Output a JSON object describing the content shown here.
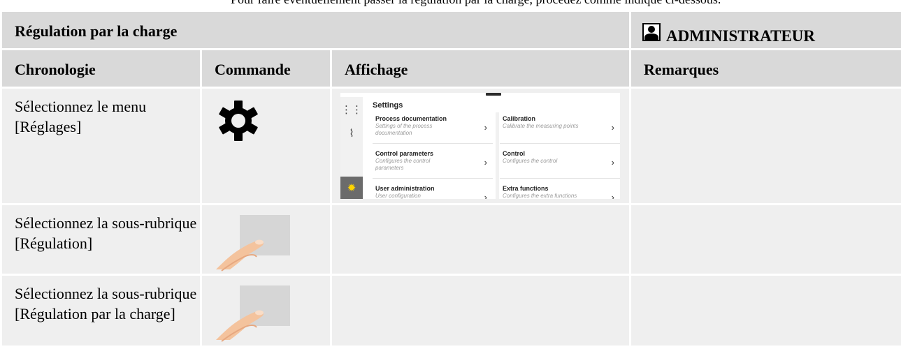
{
  "intro_text": "Pour faire éventuellement passer la régulation par la charge, procédez comme indiqué ci-dessous.",
  "header": {
    "title": "Régulation par la charge",
    "user_role": "ADMINISTRATEUR"
  },
  "columns": [
    "Chronologie",
    "Commande",
    "Affichage",
    "Remarques"
  ],
  "rows": [
    {
      "chronologie": "Sélectionnez le menu [Réglages]",
      "commande_icon": "gear-icon",
      "affichage": "settings-screen",
      "remarques": ""
    },
    {
      "chronologie": "Sélectionnez la sous-rubrique [Régulation]",
      "commande_icon": "touch-finger-icon",
      "affichage": "",
      "remarques": ""
    },
    {
      "chronologie": "Sélectionnez la sous-rubrique [Régulation par la charge]",
      "commande_icon": "touch-finger-icon",
      "affichage": "",
      "remarques": ""
    }
  ],
  "settings_screen": {
    "title": "Settings",
    "tiles": [
      {
        "title": "Process documentation",
        "desc": "Settings of the process documentation"
      },
      {
        "title": "Calibration",
        "desc": "Calibrate the measuring points"
      },
      {
        "title": "Control parameters",
        "desc": "Configures the control parameters"
      },
      {
        "title": "Control",
        "desc": "Configures the control"
      },
      {
        "title": "User administration",
        "desc": "User configuration"
      },
      {
        "title": "Extra functions",
        "desc": "Configures the extra functions"
      }
    ]
  },
  "colors": {
    "header_bg": "#d9d9d9",
    "cell_bg": "#efefef",
    "accent": "#ffd400"
  }
}
